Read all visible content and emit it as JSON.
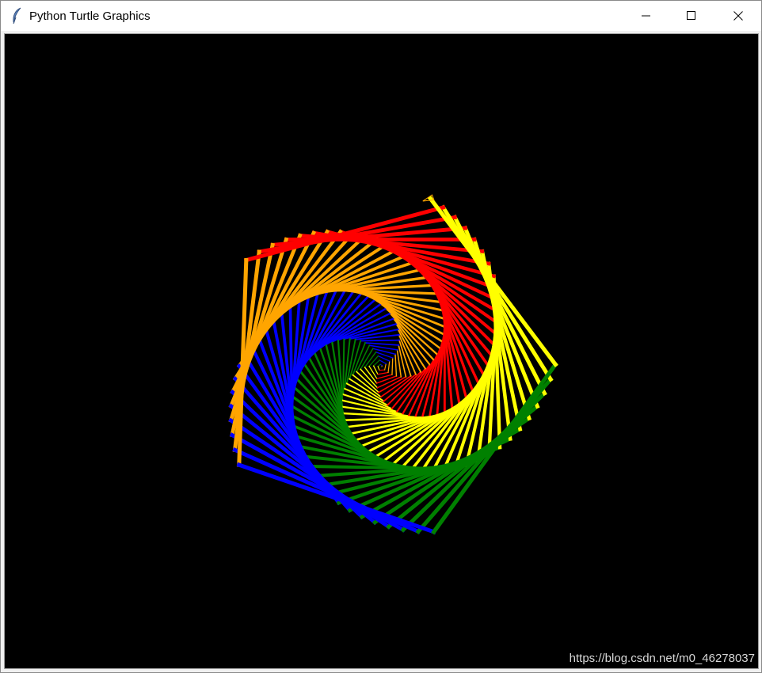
{
  "window": {
    "title": "Python Turtle Graphics",
    "icon": "feather-icon",
    "controls": [
      "minimize-icon",
      "maximize-icon",
      "close-icon"
    ]
  },
  "canvas": {
    "background": "#000000",
    "drawing": {
      "shape": "pentagon spiral",
      "colors": [
        "#ff0000",
        "#ffa500",
        "#0000ff",
        "#008000",
        "#ffff00"
      ],
      "color_names": [
        "red",
        "orange",
        "blue",
        "green",
        "yellow"
      ]
    },
    "turtle_cursor": "turtle-arrow-icon"
  },
  "watermark": {
    "text": "https://blog.csdn.net/m0_46278037",
    "color": "#d8d8d8"
  }
}
